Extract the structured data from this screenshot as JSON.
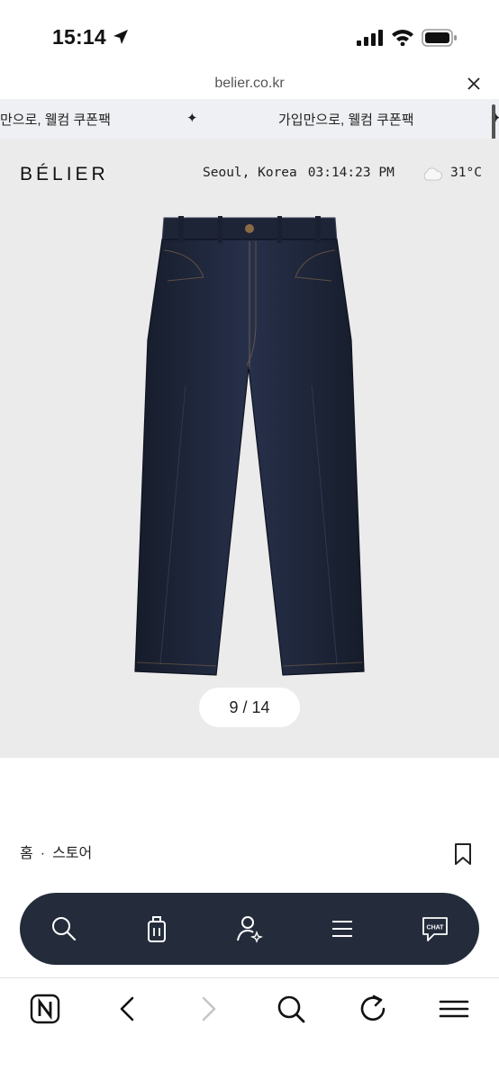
{
  "status": {
    "time": "15:14"
  },
  "browser": {
    "url": "belier.co.kr"
  },
  "banner": {
    "text_left": "만으로, 웰컴 쿠폰팩",
    "separator": "✦",
    "text_right": "가입만으로, 웰컴 쿠폰팩"
  },
  "header": {
    "logo": "BÉLIER",
    "location": "Seoul, Korea",
    "clock": "03:14:23 PM",
    "temperature": "31°C",
    "weather_icon": "cloud-icon"
  },
  "gallery": {
    "pager": "9 / 14",
    "current": 9,
    "total": 14
  },
  "breadcrumb": {
    "home": "홈",
    "separator": "·",
    "store": "스토어"
  },
  "floating_nav": {
    "items": [
      "search-icon",
      "bag-icon",
      "user-sparkle-icon",
      "menu-icon",
      "chat-icon"
    ],
    "chat_label": "CHAT"
  },
  "toolbar": {
    "items": [
      "naver-n-icon",
      "back-icon",
      "forward-icon",
      "search-icon",
      "reload-icon",
      "menu-icon"
    ]
  },
  "colors": {
    "hero_bg": "#ebebeb",
    "banner_bg": "#eef0f3",
    "nav_bg": "#242c3b",
    "denim": "#1f2637"
  }
}
